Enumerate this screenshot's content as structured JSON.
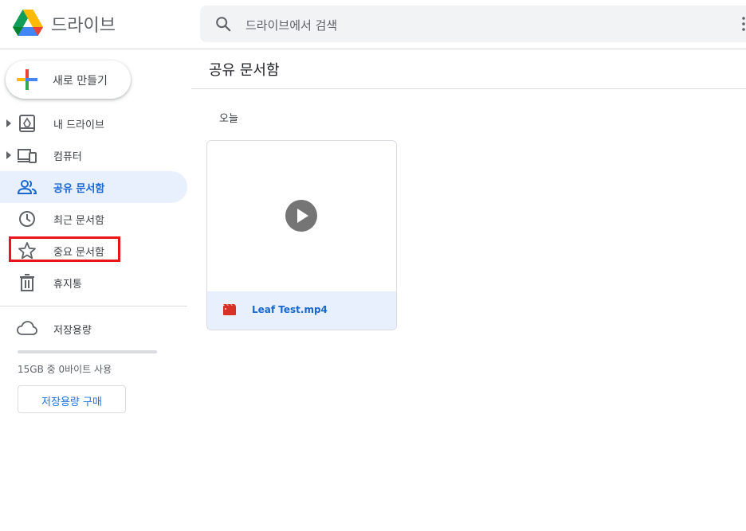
{
  "header": {
    "app_title": "드라이브",
    "search_placeholder": "드라이브에서 검색"
  },
  "sidebar": {
    "new_button": "새로 만들기",
    "items": [
      {
        "label": "내 드라이브",
        "icon": "my-drive-icon",
        "expandable": true
      },
      {
        "label": "컴퓨터",
        "icon": "computer-icon",
        "expandable": true
      },
      {
        "label": "공유 문서함",
        "icon": "shared-icon",
        "active": true
      },
      {
        "label": "최근 문서함",
        "icon": "recent-clock-icon"
      },
      {
        "label": "중요 문서함",
        "icon": "star-icon"
      },
      {
        "label": "휴지통",
        "icon": "trash-icon"
      }
    ],
    "storage": {
      "label": "저장용량",
      "usage_text": "15GB 중 0바이트 사용",
      "used_fraction": 0,
      "buy_button": "저장용량 구매"
    }
  },
  "main": {
    "title": "공유 문서함",
    "section": "오늘",
    "files": [
      {
        "name": "Leaf Test.mp4",
        "type": "video"
      }
    ]
  },
  "colors": {
    "accent": "#1a73e8",
    "active_bg": "#e8f0fe",
    "highlight": "#e8161b"
  }
}
